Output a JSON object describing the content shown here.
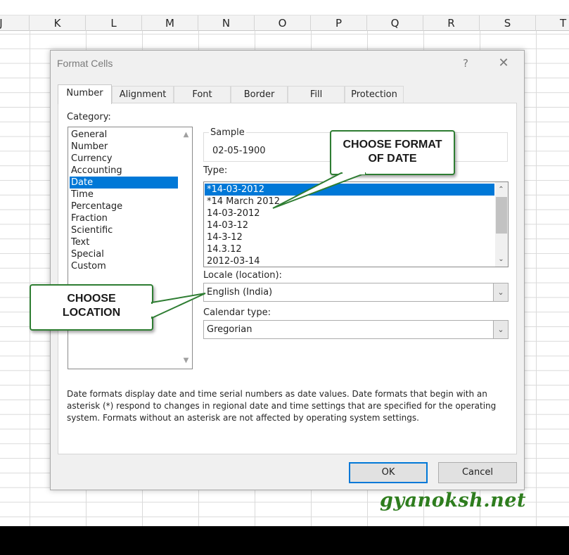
{
  "sheet": {
    "columns": [
      "J",
      "K",
      "L",
      "M",
      "N",
      "O",
      "P",
      "Q",
      "R",
      "S",
      "T"
    ]
  },
  "dialog": {
    "title": "Format Cells",
    "help_glyph": "?",
    "close_glyph": "✕",
    "tabs": [
      {
        "label": "Number",
        "active": true
      },
      {
        "label": "Alignment",
        "active": false
      },
      {
        "label": "Font",
        "active": false
      },
      {
        "label": "Border",
        "active": false
      },
      {
        "label": "Fill",
        "active": false
      },
      {
        "label": "Protection",
        "active": false
      }
    ],
    "category_label": "Category:",
    "categories": [
      "General",
      "Number",
      "Currency",
      "Accounting",
      "Date",
      "Time",
      "Percentage",
      "Fraction",
      "Scientific",
      "Text",
      "Special",
      "Custom"
    ],
    "selected_category": "Date",
    "sample_label": "Sample",
    "sample_value": "02-05-1900",
    "type_label": "Type:",
    "types": [
      "*14-03-2012",
      "*14 March 2012",
      "14-03-2012",
      "14-03-12",
      "14-3-12",
      "14.3.12",
      "2012-03-14"
    ],
    "selected_type": "*14-03-2012",
    "locale_label": "Locale (location):",
    "locale_value": "English (India)",
    "calendar_label": "Calendar type:",
    "calendar_value": "Gregorian",
    "description": "Date formats display date and time serial numbers as date values.  Date formats that begin with an asterisk (*) respond to changes in regional date and time settings that are specified for the operating system. Formats without an asterisk are not affected by operating system settings.",
    "ok_label": "OK",
    "cancel_label": "Cancel"
  },
  "callouts": {
    "date_line1": "CHOOSE FORMAT",
    "date_line2": "OF DATE",
    "location_line1": "CHOOSE",
    "location_line2": "LOCATION"
  },
  "watermark": "gyanoksh.net",
  "colors": {
    "selection": "#0078d7",
    "callout_border": "#2e7d32",
    "watermark": "#2e7d1e"
  },
  "icons": {
    "scroll_up": "chevron-up-icon",
    "scroll_down": "chevron-down-icon",
    "dropdown": "chevron-down-icon"
  }
}
